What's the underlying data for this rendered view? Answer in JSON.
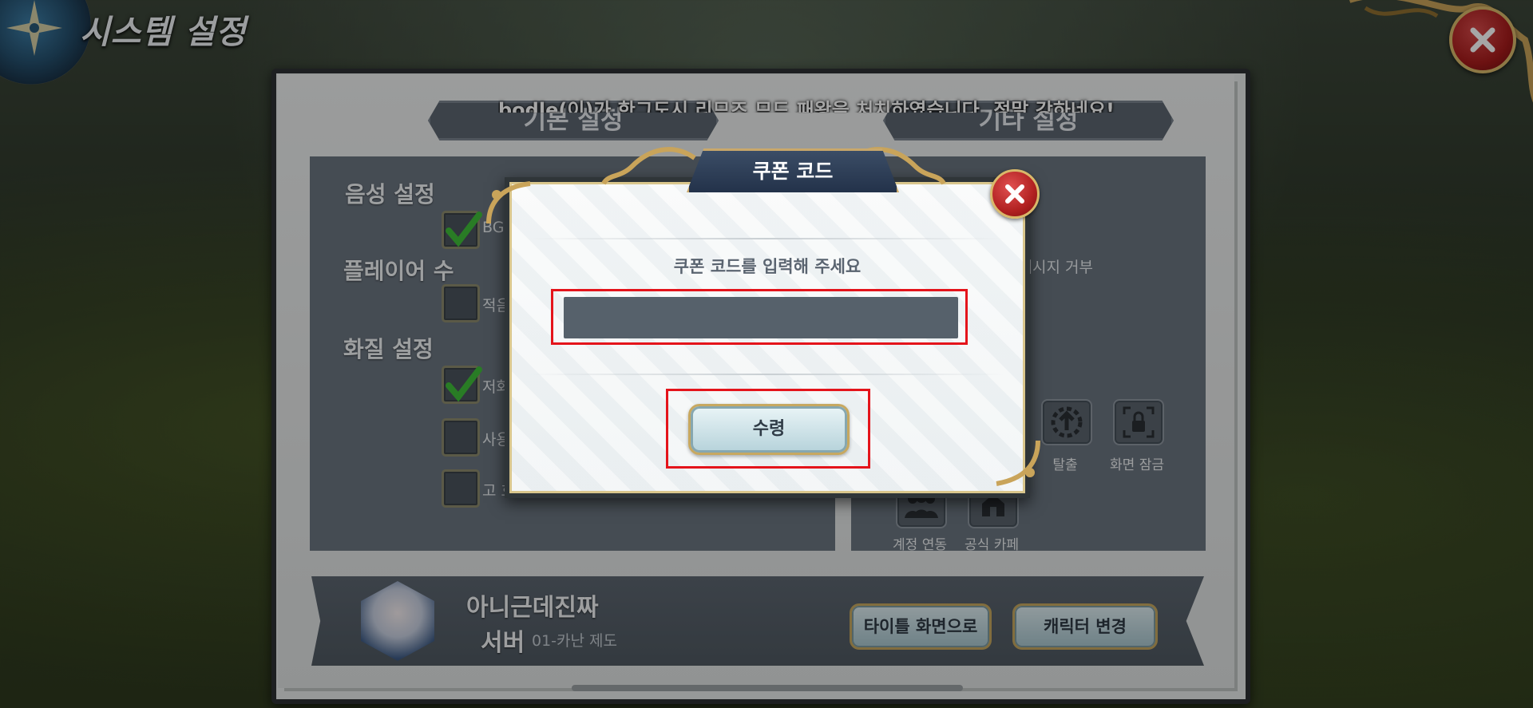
{
  "screen": {
    "title": "시스템 설정",
    "ticker": "bodle(이)가 한그도시 리므즈 므드 패왕을 처치하였습니다. 정말 강하네요!"
  },
  "tabs": [
    {
      "label": "기본 설정"
    },
    {
      "label": "기타 설정"
    }
  ],
  "basic": {
    "sound_label": "음성 설정",
    "sound_option": {
      "text": "BGM",
      "checked": true
    },
    "players_label": "플레이어 수",
    "players_option": {
      "text": "적음",
      "checked": false
    },
    "quality_label": "화질 설정",
    "quality_options": [
      {
        "text": "저화질",
        "checked": true
      },
      {
        "text": "사용",
        "checked": false
      },
      {
        "text": "고 효과",
        "checked": false
      }
    ]
  },
  "other": {
    "refuse_text": "의 메시지 거부",
    "icons": [
      {
        "label": "탈출",
        "icon": "escape-icon"
      },
      {
        "label": "화면 잠금",
        "icon": "lock-icon"
      },
      {
        "label": "계정 연동",
        "icon": "account-link-icon"
      },
      {
        "label": "공식 카페",
        "icon": "cafe-icon"
      }
    ]
  },
  "character": {
    "name": "아니근데진짜",
    "server_label": "서버",
    "server_value": "01-카난 제도"
  },
  "buttons": {
    "title_screen": "타이틀 화면으로",
    "change_character": "캐릭터 변경"
  },
  "coupon_modal": {
    "title": "쿠폰 코드",
    "prompt": "쿠폰 코드를 입력해 주세요",
    "input_value": "",
    "claim_label": "수령"
  },
  "colors": {
    "panel_gray": "#6b7580",
    "highlight_red": "#e4141b",
    "gold_trim": "#c9a86a",
    "check_green": "#3fbf3a"
  }
}
